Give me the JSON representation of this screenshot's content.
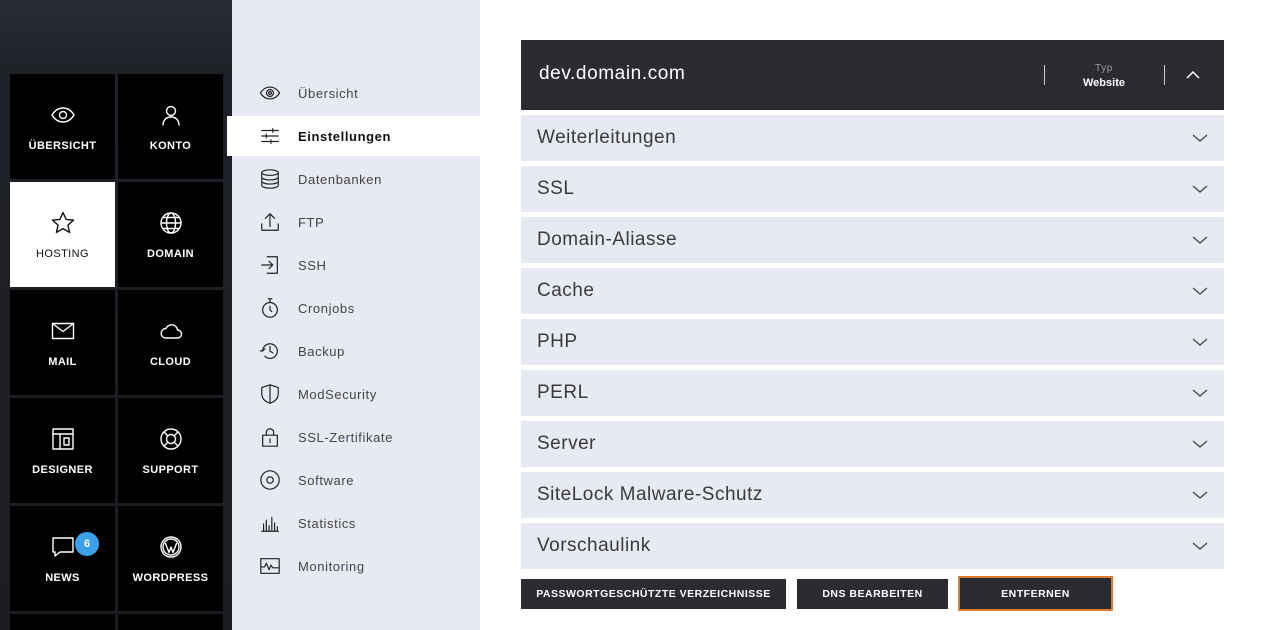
{
  "rail": {
    "tiles": [
      {
        "label": "ÜBERSICHT",
        "icon": "eye-icon"
      },
      {
        "label": "KONTO",
        "icon": "user-icon"
      },
      {
        "label": "HOSTING",
        "icon": "star-icon",
        "active": true
      },
      {
        "label": "DOMAIN",
        "icon": "globe-icon"
      },
      {
        "label": "MAIL",
        "icon": "mail-icon"
      },
      {
        "label": "CLOUD",
        "icon": "cloud-icon"
      },
      {
        "label": "DESIGNER",
        "icon": "layout-icon"
      },
      {
        "label": "SUPPORT",
        "icon": "lifebuoy-icon"
      },
      {
        "label": "NEWS",
        "icon": "chat-icon",
        "badge": "6"
      },
      {
        "label": "WORDPRESS",
        "icon": "wordpress-icon"
      }
    ]
  },
  "submenu": {
    "items": [
      {
        "label": "Übersicht",
        "icon": "eye-icon"
      },
      {
        "label": "Einstellungen",
        "icon": "sliders-icon",
        "active": true
      },
      {
        "label": "Datenbanken",
        "icon": "database-icon"
      },
      {
        "label": "FTP",
        "icon": "upload-icon"
      },
      {
        "label": "SSH",
        "icon": "login-icon"
      },
      {
        "label": "Cronjobs",
        "icon": "stopwatch-icon"
      },
      {
        "label": "Backup",
        "icon": "history-icon"
      },
      {
        "label": "ModSecurity",
        "icon": "shield-icon"
      },
      {
        "label": "SSL-Zertifikate",
        "icon": "lock-icon"
      },
      {
        "label": "Software",
        "icon": "disc-icon"
      },
      {
        "label": "Statistics",
        "icon": "bar-chart-icon"
      },
      {
        "label": "Monitoring",
        "icon": "pulse-icon"
      }
    ]
  },
  "header": {
    "domain": "dev.domain.com",
    "typ_label": "Typ",
    "typ_value": "Website"
  },
  "sections": [
    {
      "label": "Weiterleitungen"
    },
    {
      "label": "SSL"
    },
    {
      "label": "Domain-Aliasse"
    },
    {
      "label": "Cache"
    },
    {
      "label": "PHP"
    },
    {
      "label": "PERL"
    },
    {
      "label": "Server"
    },
    {
      "label": "SiteLock Malware-Schutz"
    },
    {
      "label": "Vorschaulink"
    }
  ],
  "actions": {
    "protected_dirs": "PASSWORTGESCHÜTZTE VERZEICHNISSE",
    "dns_edit": "DNS BEARBEITEN",
    "remove": "ENTFERNEN"
  },
  "colors": {
    "rail_tile": "#000000",
    "submenu_bg": "#e8eaf3",
    "header_bg": "#2b2c31",
    "badge": "#3aa0e8",
    "focus_outline": "#e07b2f"
  }
}
